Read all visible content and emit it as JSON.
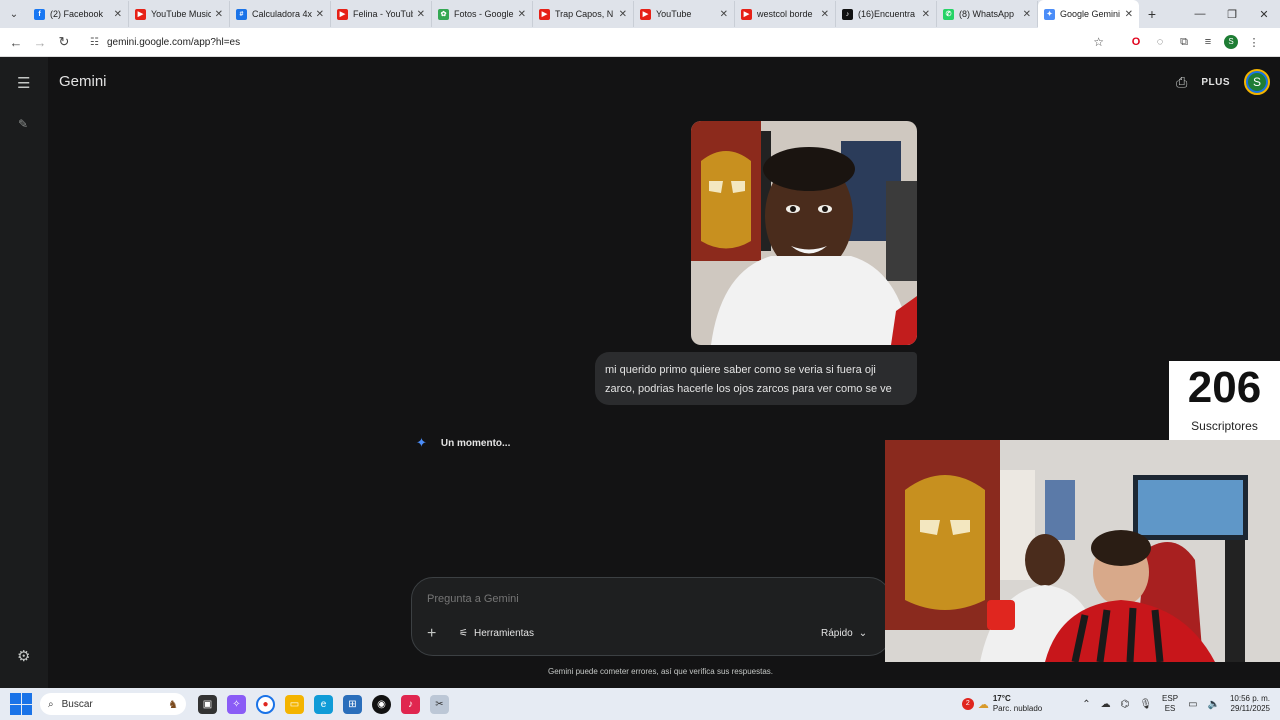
{
  "browser": {
    "tabs": [
      {
        "title": "(2) Facebook",
        "icon": "facebook-icon",
        "color": "#1877f2",
        "glyph": "f"
      },
      {
        "title": "YouTube Music",
        "icon": "youtube-music-icon",
        "color": "#e62117",
        "glyph": "▶"
      },
      {
        "title": "Calculadora 4x",
        "icon": "calculator-icon",
        "color": "#1a73e8",
        "glyph": "#"
      },
      {
        "title": "Felina - YouTube",
        "icon": "youtube-icon",
        "color": "#e62117",
        "glyph": "▶"
      },
      {
        "title": "Fotos - Google",
        "icon": "google-photos-icon",
        "color": "#34a853",
        "glyph": "✿"
      },
      {
        "title": "Trap Capos, N",
        "icon": "youtube-icon",
        "color": "#e62117",
        "glyph": "▶"
      },
      {
        "title": "YouTube",
        "icon": "youtube-icon",
        "color": "#e62117",
        "glyph": "▶"
      },
      {
        "title": "westcol borde",
        "icon": "youtube-icon",
        "color": "#e62117",
        "glyph": "▶"
      },
      {
        "title": "(16)Encuentra",
        "icon": "tiktok-icon",
        "color": "#111111",
        "glyph": "♪"
      },
      {
        "title": "(8) WhatsApp",
        "icon": "whatsapp-icon",
        "color": "#25d366",
        "glyph": "✆"
      },
      {
        "title": "Google Gemini",
        "icon": "gemini-icon",
        "color": "#4b8df8",
        "glyph": "✦"
      }
    ],
    "new_tab": "+",
    "url": "gemini.google.com/app?hl=es",
    "profile_initial": "S"
  },
  "gemini": {
    "brand": "Gemini",
    "plan": "PLUS",
    "avatar_initial": "S",
    "user_message": "mi querido primo quiere saber como se veria si fuera oji zarco, podrias hacerle los ojos zarcos para ver como se ve",
    "loading_text": "Un momento...",
    "input_placeholder": "Pregunta a Gemini",
    "tools_label": "Herramientas",
    "mode_label": "Rápido",
    "disclaimer": "Gemini puede cometer errores, así que verifica sus respuestas."
  },
  "overlay": {
    "subscriber_count": "206",
    "subscriber_label": "Suscriptores"
  },
  "taskbar": {
    "search_label": "Buscar",
    "weather_temp": "17°C",
    "weather_desc": "Parc. nublado",
    "weather_badge": "2",
    "lang_top": "ESP",
    "lang_bottom": "ES",
    "time": "10:56 p. m.",
    "date": "29/11/2025"
  }
}
